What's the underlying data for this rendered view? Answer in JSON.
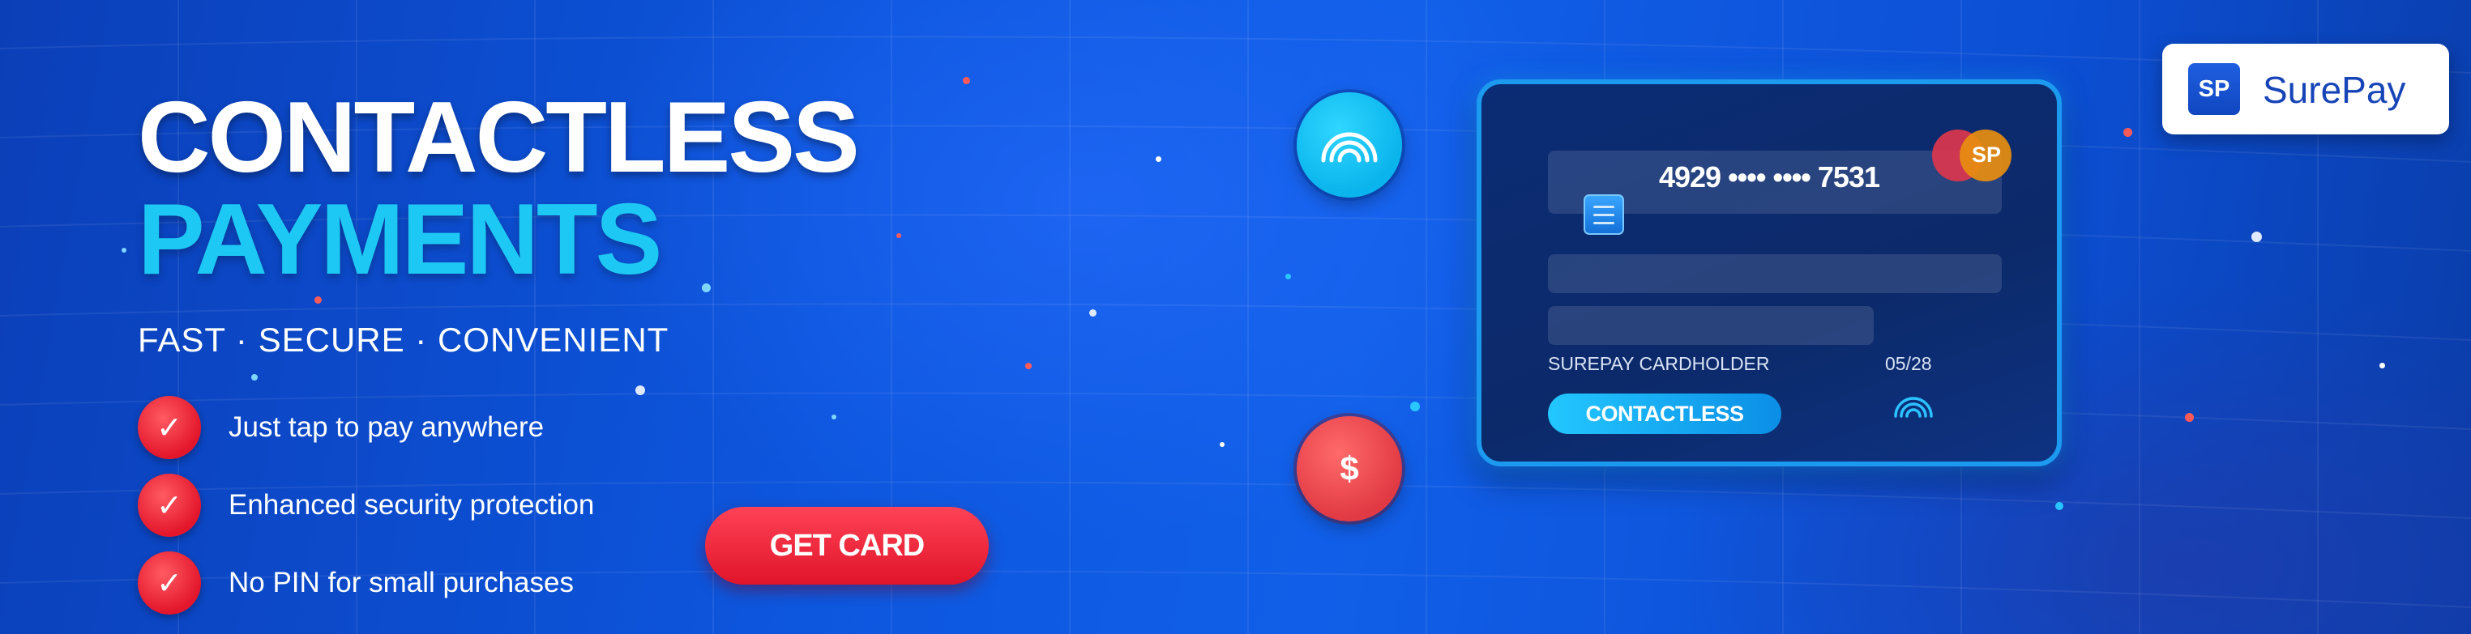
{
  "headline": {
    "line1": "CONTACTLESS",
    "line2": "PAYMENTS"
  },
  "tagline": "FAST · SECURE · CONVENIENT",
  "features": [
    {
      "check": "✓",
      "text": "Just tap to pay anywhere"
    },
    {
      "check": "✓",
      "text": "Enhanced security protection"
    },
    {
      "check": "✓",
      "text": "No PIN for small purchases"
    }
  ],
  "cta": {
    "label": "GET CARD"
  },
  "dollar_badge": "$",
  "card": {
    "number": "4929 •••• •••• 7531",
    "brand_mark": "SP",
    "holder": "SUREPAY CARDHOLDER",
    "expiry": "05/28",
    "badge": "CONTACTLESS"
  },
  "logo": {
    "mark": "SP",
    "name": "SurePay"
  },
  "colors": {
    "background": "#0d56de",
    "accent_cyan": "#1ec8f4",
    "accent_red": "#e3162b",
    "card_bg": "#0b2c74",
    "card_border": "#1b9af0",
    "logo_blue": "#1745b8"
  },
  "icons": [
    "contactless-wave-icon",
    "dollar-icon",
    "card-chip-icon",
    "checkmark-icon"
  ]
}
